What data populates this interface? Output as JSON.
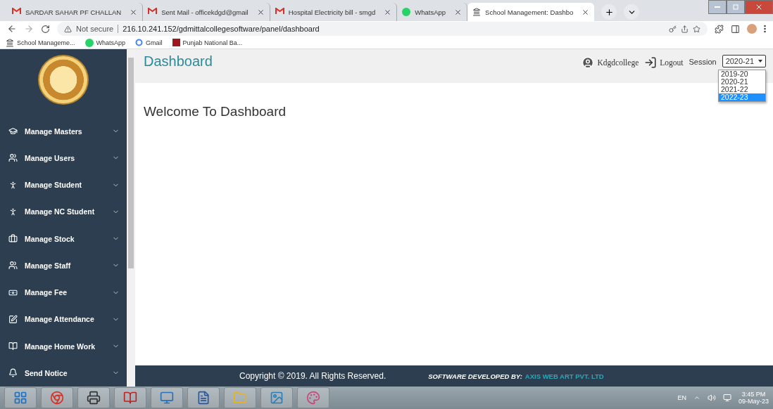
{
  "browser": {
    "tabs": [
      {
        "title": "SARDAR SAHAR PF CHALLAN",
        "kind": "gmail",
        "selected": false
      },
      {
        "title": "Sent Mail - officekdgd@gmail",
        "kind": "gmail",
        "selected": false
      },
      {
        "title": "Hospital Electricity bill - smgd",
        "kind": "gmail",
        "selected": false
      },
      {
        "title": "WhatsApp",
        "kind": "whatsapp",
        "selected": false
      },
      {
        "title": "School Management: Dashbo",
        "kind": "school",
        "selected": true
      }
    ],
    "security": "Not secure",
    "url": "216.10.241.152/gdmittalcollegesoftware/panel/dashboard",
    "bookmarks": [
      {
        "label": "School Manageme...",
        "kind": "school"
      },
      {
        "label": "WhatsApp",
        "kind": "whatsapp"
      },
      {
        "label": "Gmail",
        "kind": "google"
      },
      {
        "label": "Punjab National Ba...",
        "kind": "bank"
      }
    ]
  },
  "sidebar": {
    "items": [
      {
        "label": "Manage Masters",
        "kind": "cap"
      },
      {
        "label": "Manage Users",
        "kind": "users"
      },
      {
        "label": "Manage Student",
        "kind": "person"
      },
      {
        "label": "Manage NC Student",
        "kind": "person"
      },
      {
        "label": "Manage Stock",
        "kind": "bag"
      },
      {
        "label": "Manage Staff",
        "kind": "users"
      },
      {
        "label": "Manage Fee",
        "kind": "money"
      },
      {
        "label": "Manage Attendance",
        "kind": "edit"
      },
      {
        "label": "Manage Home Work",
        "kind": "book"
      },
      {
        "label": "Send Notice",
        "kind": "bell"
      }
    ]
  },
  "header": {
    "title": "Dashboard",
    "user": "Kdgdcollege",
    "logout": "Logout",
    "session_label": "Session",
    "session_value": "2020-21",
    "session_options": [
      {
        "label": "2019-20",
        "selected": false
      },
      {
        "label": "2020-21",
        "selected": false
      },
      {
        "label": "2021-22",
        "selected": false
      },
      {
        "label": "2022-23",
        "selected": true
      }
    ]
  },
  "content": {
    "welcome": "Welcome To Dashboard"
  },
  "footer": {
    "copyright": "Copyright © 2019. All Rights Reserved.",
    "developed_by": "SOFTWARE DEVELOPED BY:",
    "company": "AXIS WEB ART PVT. LTD"
  },
  "taskbar": {
    "apps": [
      {
        "kind": "windows"
      },
      {
        "kind": "chrome"
      },
      {
        "kind": "printer"
      },
      {
        "kind": "reader"
      },
      {
        "kind": "control"
      },
      {
        "kind": "word"
      },
      {
        "kind": "folder"
      },
      {
        "kind": "picture"
      },
      {
        "kind": "paint"
      }
    ],
    "language": "EN",
    "time": "3:45 PM",
    "date": "09-May-23"
  }
}
